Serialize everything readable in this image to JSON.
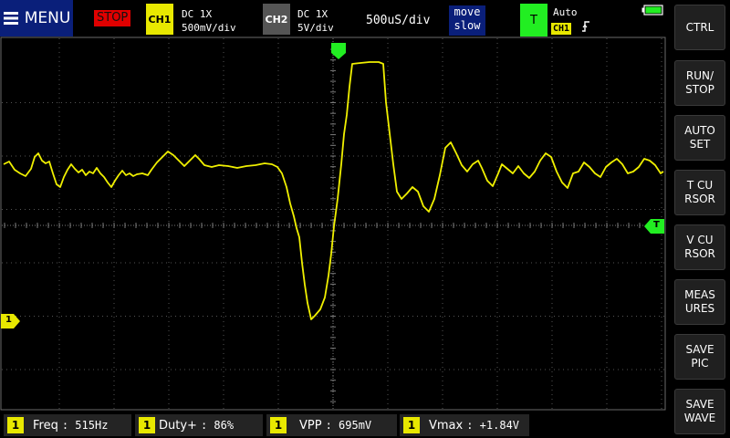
{
  "top_bar": {
    "menu_label": "MENU",
    "run_state": "STOP",
    "ch1": {
      "badge": "CH1",
      "coupling": "DC  1X",
      "scale": "500mV/div",
      "color": "#e8e800"
    },
    "ch2": {
      "badge": "CH2",
      "coupling": "DC  1X",
      "scale": "5V/div",
      "color": "#555555"
    },
    "timebase": "500uS/div",
    "move_line1": "move",
    "move_line2": "slow",
    "trigger": {
      "badge": "T",
      "mode": "Auto",
      "source": "CH1",
      "edge": "rising"
    },
    "battery": "full"
  },
  "markers": {
    "ch1_ground": "1",
    "trigger_level": "T"
  },
  "side_buttons": [
    "CTRL",
    "RUN/\nSTOP",
    "AUTO\nSET",
    "T CU\nRSOR",
    "V CU\nRSOR",
    "MEAS\nURES",
    "SAVE\nPIC",
    "SAVE\nWAVE"
  ],
  "measurements": [
    {
      "ch": "1",
      "label": "Freq",
      "value": ": 515Hz"
    },
    {
      "ch": "1",
      "label": "Duty+",
      "value": ": 86%"
    },
    {
      "ch": "1",
      "label": "VPP",
      "value": ": 695mV"
    },
    {
      "ch": "1",
      "label": "Vmax",
      "value": ": +1.84V"
    }
  ],
  "colors": {
    "trace": "#f0f000",
    "trigger": "#22ee22",
    "stop": "#e00000",
    "menu_bg": "#0a1f7a"
  }
}
